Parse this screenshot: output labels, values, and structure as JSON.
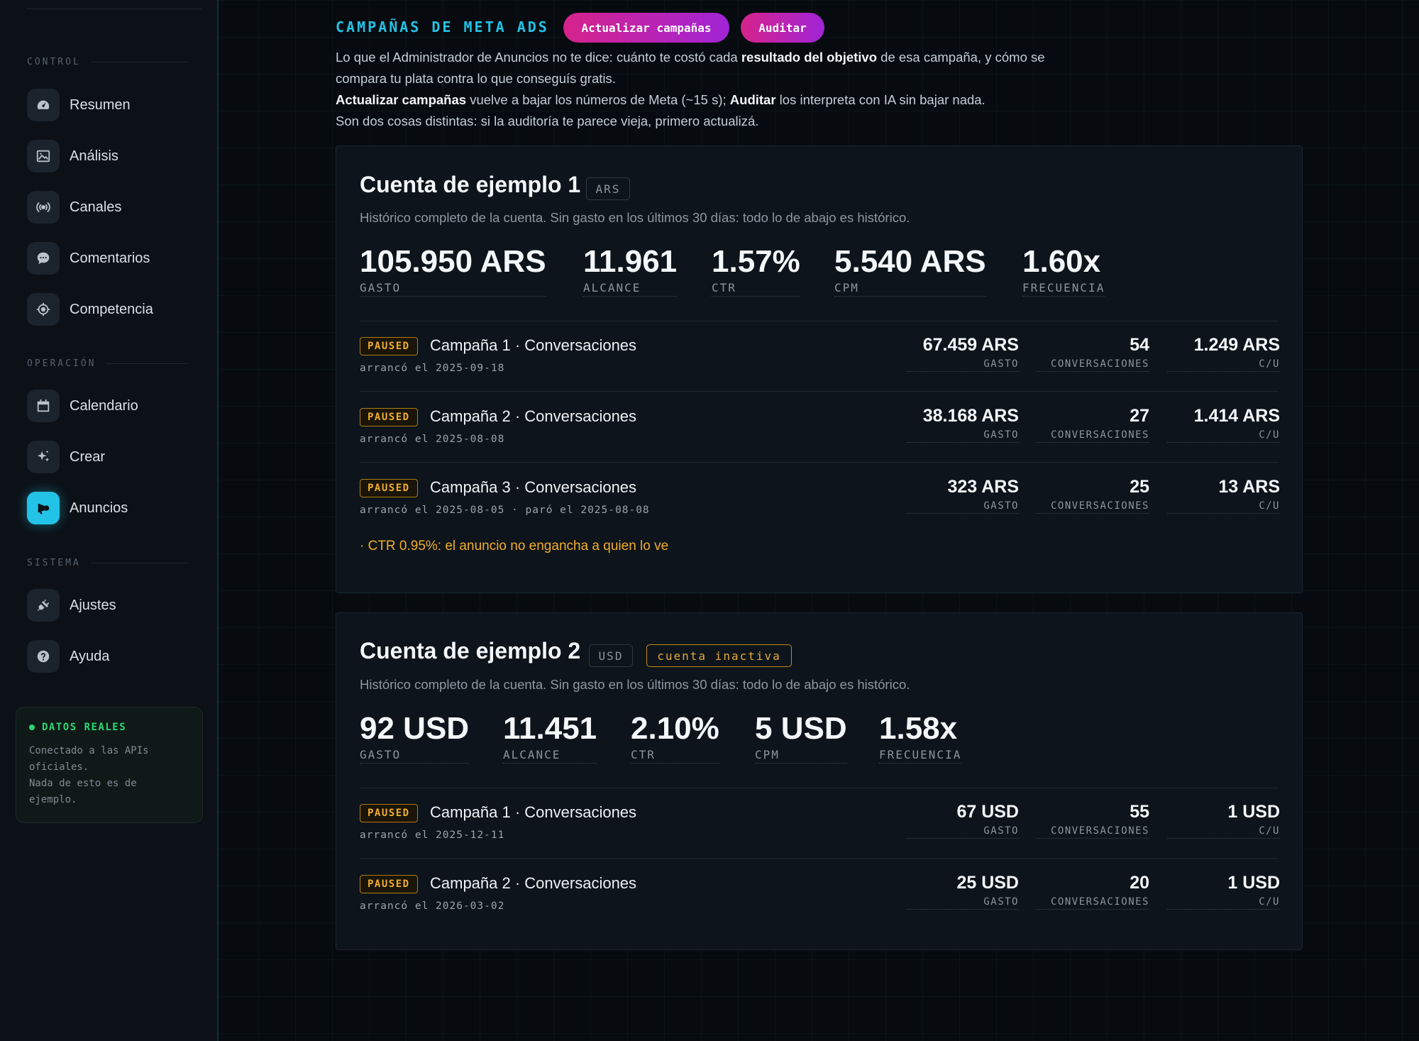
{
  "sidebar": {
    "sections": {
      "control": "CONTROL",
      "operacion": "OPERACIÓN",
      "sistema": "SISTEMA"
    },
    "items": [
      {
        "label": "Resumen",
        "icon": "dashboard-gauge-icon"
      },
      {
        "label": "Análisis",
        "icon": "image-chart-icon"
      },
      {
        "label": "Canales",
        "icon": "broadcast-icon"
      },
      {
        "label": "Comentarios",
        "icon": "chat-bubble-icon"
      },
      {
        "label": "Competencia",
        "icon": "target-icon"
      },
      {
        "label": "Calendario",
        "icon": "calendar-icon"
      },
      {
        "label": "Crear",
        "icon": "sparkle-icon"
      },
      {
        "label": "Anuncios",
        "icon": "megaphone-icon",
        "active": true
      },
      {
        "label": "Ajustes",
        "icon": "plug-icon"
      },
      {
        "label": "Ayuda",
        "icon": "help-icon"
      }
    ],
    "status": {
      "title": "DATOS REALES",
      "line1": "Conectado a las APIs",
      "line2": "oficiales.",
      "line3": "Nada de esto es de",
      "line4": "ejemplo."
    }
  },
  "header": {
    "title": "CAMPAÑAS DE META ADS",
    "update_button": "Actualizar campañas",
    "audit_button": "Auditar",
    "intro": {
      "p1_a": "Lo que el Administrador de Anuncios no te dice: cuánto te costó cada ",
      "p1_b": "resultado del objetivo",
      "p1_c": " de esa campaña, y cómo se compara tu plata contra lo que conseguís gratis.",
      "p2_a": "Actualizar campañas",
      "p2_b": " vuelve a bajar los números de Meta (~15 s); ",
      "p2_c": "Auditar",
      "p2_d": " los interpreta con IA sin bajar nada.",
      "p3": "Son dos cosas distintas: si la auditoría te parece vieja, primero actualizá."
    }
  },
  "accounts": [
    {
      "name": "Cuenta de ejemplo 1",
      "currency": "ARS",
      "subtitle": "Histórico completo de la cuenta. Sin gasto en los últimos 30 días: todo lo de abajo es histórico.",
      "kpis": [
        {
          "value": "105.950 ARS",
          "label": "GASTO"
        },
        {
          "value": "11.961",
          "label": "ALCANCE"
        },
        {
          "value": "1.57%",
          "label": "CTR"
        },
        {
          "value": "5.540 ARS",
          "label": "CPM"
        },
        {
          "value": "1.60x",
          "label": "FRECUENCIA"
        }
      ],
      "campaigns": [
        {
          "status": "PAUSED",
          "name": "Campaña 1 · Conversaciones",
          "dates": "arrancó el 2025-09-18",
          "spend": "67.459 ARS",
          "results": "54",
          "cpu": "1.249 ARS"
        },
        {
          "status": "PAUSED",
          "name": "Campaña 2 · Conversaciones",
          "dates": "arrancó el 2025-08-08",
          "spend": "38.168 ARS",
          "results": "27",
          "cpu": "1.414 ARS"
        },
        {
          "status": "PAUSED",
          "name": "Campaña 3 · Conversaciones",
          "dates": "arrancó el 2025-08-05 · paró el 2025-08-08",
          "spend": "323 ARS",
          "results": "25",
          "cpu": "13 ARS"
        }
      ],
      "warning": "· CTR 0.95%: el anuncio no engancha a quien lo ve"
    },
    {
      "name": "Cuenta de ejemplo 2",
      "currency": "USD",
      "inactive": "cuenta inactiva",
      "subtitle": "Histórico completo de la cuenta. Sin gasto en los últimos 30 días: todo lo de abajo es histórico.",
      "kpis": [
        {
          "value": "92 USD",
          "label": "GASTO"
        },
        {
          "value": "11.451",
          "label": "ALCANCE"
        },
        {
          "value": "2.10%",
          "label": "CTR"
        },
        {
          "value": "5 USD",
          "label": "CPM"
        },
        {
          "value": "1.58x",
          "label": "FRECUENCIA"
        }
      ],
      "campaigns": [
        {
          "status": "PAUSED",
          "name": "Campaña 1 · Conversaciones",
          "dates": "arrancó el 2025-12-11",
          "spend": "67 USD",
          "results": "55",
          "cpu": "1 USD"
        },
        {
          "status": "PAUSED",
          "name": "Campaña 2 · Conversaciones",
          "dates": "arrancó el 2026-03-02",
          "spend": "25 USD",
          "results": "20",
          "cpu": "1 USD"
        }
      ]
    }
  ],
  "metric_labels": {
    "spend": "GASTO",
    "results": "CONVERSACIONES",
    "cpu": "C/U"
  },
  "colors": {
    "accent": "#22c3e6",
    "button_gradient_start": "#d6238b",
    "button_gradient_end": "#a024d6",
    "paused": "#f0ad2e",
    "live": "#2ed673"
  }
}
